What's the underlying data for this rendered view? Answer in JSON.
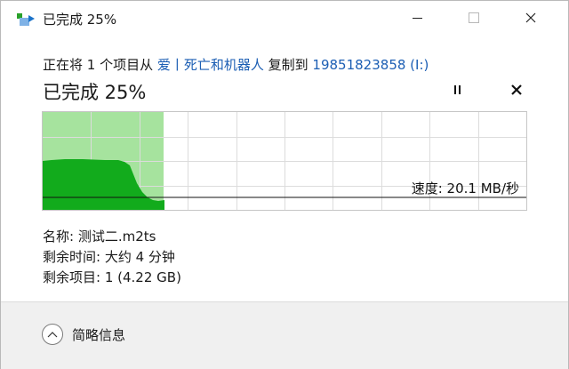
{
  "window": {
    "title": "已完成 25%"
  },
  "header": {
    "prefix": "正在将 1 个项目从 ",
    "source": "爱丨死亡和机器人",
    "middle": " 复制到 ",
    "destination": "19851823858 (I:)",
    "progress_title": "已完成 25%"
  },
  "progress": {
    "fraction": 0.25
  },
  "speed": {
    "label": "速度: 20.1 MB/秒"
  },
  "details": {
    "name": "名称: 测试二.m2ts",
    "time_remaining": "剩余时间: 大约 4 分钟",
    "items_remaining": "剩余项目: 1 (4.22 GB)"
  },
  "footer": {
    "less_info": "简略信息"
  },
  "colors": {
    "fill": "#a6e39e",
    "speed_area": "#12ab1c",
    "grid": "#dcdcdc",
    "link": "#1d5fb4"
  }
}
